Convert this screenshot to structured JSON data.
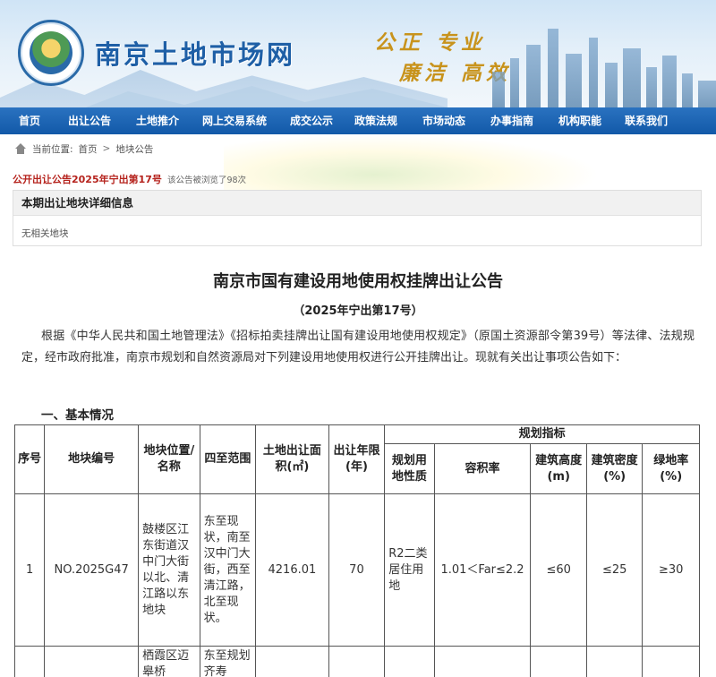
{
  "header": {
    "site_title": "南京土地市场网",
    "slogan_line1": "公正  专业",
    "slogan_line2": "廉洁  高效"
  },
  "nav": {
    "items": [
      "首页",
      "出让公告",
      "土地推介",
      "网上交易系统",
      "成交公示",
      "政策法规",
      "市场动态",
      "办事指南",
      "机构职能",
      "联系我们"
    ]
  },
  "breadcrumb": {
    "label": "当前位置:",
    "home": "首页",
    "separator": ">",
    "current": "地块公告"
  },
  "notice": {
    "title": "公开出让公告2025年宁出第17号",
    "views": "该公告被浏览了98次"
  },
  "panel": {
    "title": "本期出让地块详细信息",
    "body": "无相关地块"
  },
  "document": {
    "title": "南京市国有建设用地使用权挂牌出让公告",
    "subtitle": "（2025年宁出第17号）",
    "paragraph": "根据《中华人民共和国土地管理法》《招标拍卖挂牌出让国有建设用地使用权规定》（原国土资源部令第39号）等法律、法规规定，经市政府批准，南京市规划和自然资源局对下列建设用地使用权进行公开挂牌出让。现就有关出让事项公告如下：",
    "section1": "一、基本情况"
  },
  "table": {
    "headers": {
      "seq": "序号",
      "code": "地块编号",
      "location": "地块位置/名称",
      "bounds": "四至范围",
      "area": "土地出让面积(㎡)",
      "term": "出让年限(年)",
      "planning": "规划指标",
      "use": "规划用地性质",
      "far": "容积率",
      "height": "建筑高度(m)",
      "density": "建筑密度(%)",
      "green": "绿地率(%)"
    },
    "rows": [
      {
        "seq": "1",
        "code": "NO.2025G47",
        "location": "鼓楼区江东街道汉中门大街以北、清江路以东地块",
        "bounds": "东至现状，南至汉中门大街，西至清江路，北至现状。",
        "area": "4216.01",
        "term": "70",
        "use": "R2二类居住用地",
        "far": "1.01＜Far≤2.2",
        "height": "≤60",
        "density": "≤25",
        "green": "≥30"
      },
      {
        "seq": "",
        "code": "",
        "location": "栖霞区迈皋桥",
        "bounds": "东至规划齐寿",
        "area": "",
        "term": "",
        "use": "",
        "far": "",
        "height": "",
        "density": "",
        "green": ""
      }
    ]
  }
}
